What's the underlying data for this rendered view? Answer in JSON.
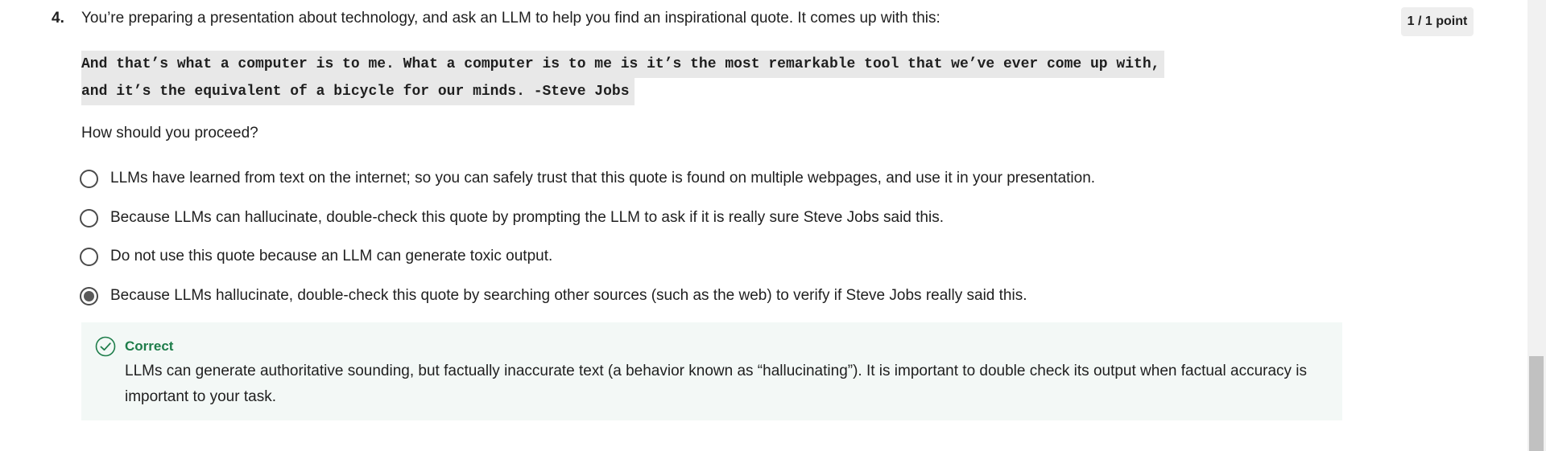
{
  "question": {
    "number": "4.",
    "text": "You’re preparing a presentation about technology, and ask an LLM to help you find an inspirational quote. It comes up with this:",
    "points": "1 / 1 point",
    "quote_lines": [
      "And that’s what a computer is to me. What a computer is to me is it’s the most remarkable tool that we’ve ever come up with,",
      "and it’s the equivalent of a bicycle for our minds. -Steve Jobs"
    ],
    "prompt": "How should you proceed?"
  },
  "options": [
    {
      "label": "LLMs have learned from text on the internet; so you can safely trust that this quote is found on multiple webpages, and use it in your presentation.",
      "selected": false
    },
    {
      "label": "Because LLMs can hallucinate, double-check this quote by prompting the LLM to ask if it is really sure Steve Jobs said this.",
      "selected": false
    },
    {
      "label": "Do not use this quote because an LLM can generate toxic output.",
      "selected": false
    },
    {
      "label": "Because LLMs hallucinate, double-check this quote by searching other sources (such as the web) to verify if Steve Jobs really said this.",
      "selected": true
    }
  ],
  "feedback": {
    "icon": "check-circle-icon",
    "title": "Correct",
    "text": "LLMs can generate authoritative sounding, but factually inaccurate text (a behavior known as “hallucinating”). It is important to double check its output when factual accuracy is important to your task."
  },
  "colors": {
    "correct": "#1e7d4a",
    "feedback_bg": "#f3f8f6"
  }
}
